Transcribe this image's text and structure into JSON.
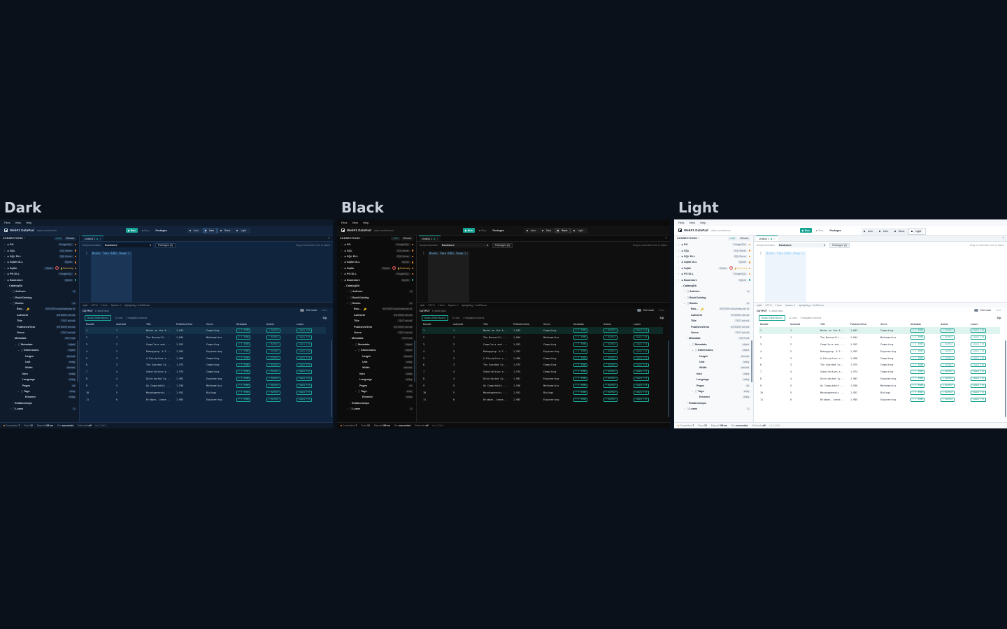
{
  "themes": [
    {
      "title": "Dark"
    },
    {
      "title": "Black"
    },
    {
      "title": "Light"
    }
  ],
  "menu": [
    "Files",
    "View",
    "Help"
  ],
  "app": {
    "name": "WebF1 DataPad",
    "subtitle": "data workbench",
    "run": "Run",
    "stop": "Stop",
    "packages": "Packages",
    "theme_options": [
      "Auto",
      "Dark",
      "Black",
      "Light"
    ]
  },
  "sidebar": {
    "title": "CONNECTIONS",
    "count": "7",
    "add": "Add",
    "reload": "Reload",
    "connections": [
      {
        "label": "PG",
        "tag": "PostgreSQL",
        "status": "orange"
      },
      {
        "label": "SQL",
        "tag": "SQL Server",
        "status": "orange"
      },
      {
        "label": "SQL DLL",
        "tag": "SQL Server",
        "status": "orange"
      },
      {
        "label": "Sqlite DLL",
        "tag": "SQLite",
        "status": "orange"
      },
      {
        "label": "Sqlite",
        "tag": "SQLite",
        "badge": "P",
        "extra": "Read-only",
        "status": "orange"
      },
      {
        "label": "PG DLL",
        "tag": "PostgreSQL",
        "status": "orange"
      },
      {
        "label": "Bookstore",
        "tag": "SQLite",
        "status": "teal"
      }
    ],
    "schema": [
      {
        "label": "CatalogDb",
        "depth": 1,
        "tag": ""
      },
      {
        "label": "Authors",
        "depth": 2,
        "tag": "4"
      },
      {
        "label": "BookCatalog",
        "depth": 2,
        "tag": ""
      },
      {
        "label": "Books",
        "depth": 2,
        "tag": "11"
      },
      {
        "label": "Boo...",
        "depth": 3,
        "tag": "INTEGER null primary key ID"
      },
      {
        "label": "AuthorId",
        "depth": 3,
        "tag": "INTEGER not null"
      },
      {
        "label": "Title",
        "depth": 3,
        "tag": "TEXT not null"
      },
      {
        "label": "PublishedYear",
        "depth": 3,
        "tag": "INTEGER not null"
      },
      {
        "label": "Genre",
        "depth": 3,
        "tag": "TEXT not null"
      },
      {
        "label": "Metadata",
        "depth": 3,
        "tag": "TEXT null"
      },
      {
        "label": "Metadata",
        "depth": 4,
        "tag": "object"
      },
      {
        "label": "Dimensions",
        "depth": 5,
        "tag": "object"
      },
      {
        "label": "Height",
        "depth": 6,
        "tag": "decimal"
      },
      {
        "label": "Unit",
        "depth": 6,
        "tag": "string"
      },
      {
        "label": "Width",
        "depth": 6,
        "tag": "decimal"
      },
      {
        "label": "Isbn",
        "depth": 5,
        "tag": "string"
      },
      {
        "label": "Language",
        "depth": 5,
        "tag": "string"
      },
      {
        "label": "Pages",
        "depth": 5,
        "tag": "int"
      },
      {
        "label": "Tags",
        "depth": 5,
        "tag": "array"
      },
      {
        "label": "Element",
        "depth": 6,
        "tag": "string"
      },
      {
        "label": "Relationships",
        "depth": 3,
        "tag": ""
      },
      {
        "label": "Loans",
        "depth": 2,
        "tag": "1"
      }
    ]
  },
  "tab": {
    "label": "Untitled 1"
  },
  "scriptbar": {
    "label": "Script connection",
    "connection": "Bookstore",
    "packages": "Packages (0)",
    "drag": "Drag a connection here to attach"
  },
  "editor": {
    "line": "1",
    "code": "Books.Take(100).Dump();"
  },
  "infobar": [
    "sqlite",
    "UTF-8",
    "1 lines",
    "Spaces: 4",
    "highlighting + IntelliSense"
  ],
  "output": {
    "title": "OUTPUT",
    "blocks": "1 result block",
    "edit_mode": "Edit mode",
    "save": "Save",
    "result_name": "Books (Table<Book>)",
    "rows": "11 rows",
    "nav": "3 navigation columns",
    "sql": "SQL"
  },
  "table": {
    "columns": [
      "BookId",
      "AuthorId",
      "Title",
      "PublishedYear",
      "Genre",
      "Metadata",
      "Author",
      "Loans"
    ],
    "rows": [
      [
        "1",
        "1",
        "Notes on the A...",
        "1,843",
        "Computing"
      ],
      [
        "2",
        "1",
        "The Bernoulli ...",
        "1,844",
        "Mathematics"
      ],
      [
        "3",
        "2",
        "Compilers and ...",
        "1,952",
        "Computing"
      ],
      [
        "4",
        "2",
        "Debugging: A F...",
        "1,953",
        "Engineering"
      ],
      [
        "5",
        "3",
        "A Discipline o...",
        "1,968",
        "Computing"
      ],
      [
        "6",
        "3",
        "The Guarded Co...",
        "1,975",
        "Computing"
      ],
      [
        "7",
        "4",
        "Substitution a...",
        "1,974",
        "Computing"
      ],
      [
        "8",
        "4",
        "Distributed Sy...",
        "1,982",
        "Engineering"
      ],
      [
        "9",
        "5",
        "On Computable ...",
        "1,936",
        "Mathematics"
      ],
      [
        "10",
        "5",
        "Morphogenesis ...",
        "1,952",
        "Biology"
      ],
      [
        "11",
        "6",
        "Bridges, Leave...",
        "1,985",
        "Engineering"
      ]
    ],
    "meta_chip": "{ } JSON",
    "author_chip": "↗ Author",
    "loans_chip": "Loans [1]"
  },
  "status": {
    "connections": "Connections",
    "connections_n": "7",
    "rows": "Rows",
    "rows_n": "12",
    "elapsed": "Elapsed",
    "elapsed_v": "199 ms",
    "run": "Run",
    "run_v": "succeeded",
    "edit": "Edit mode",
    "edit_v": "off",
    "pos": "Ln 1, Col 1"
  }
}
